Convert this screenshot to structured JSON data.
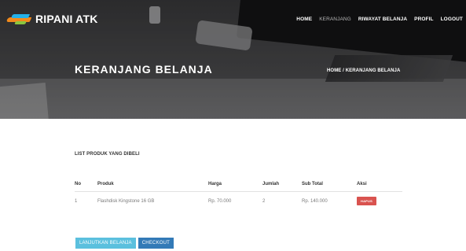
{
  "brand": {
    "name": "RIPANI ATK",
    "logo_colors": [
      "#f28a1c",
      "#23b0e8",
      "#8cc63f"
    ]
  },
  "nav": {
    "items": [
      {
        "label": "HOME"
      },
      {
        "label": "KERANJANG"
      },
      {
        "label": "RIWAYAT BELANJA"
      },
      {
        "label": "PROFIL"
      },
      {
        "label": "LOGOUT"
      }
    ]
  },
  "hero": {
    "title": "KERANJANG BELANJA",
    "breadcrumb": "HOME / KERANJANG BELANJA"
  },
  "cart": {
    "section_title": "LIST PRODUK YANG DIBELI",
    "columns": [
      "No",
      "Produk",
      "Harga",
      "Jumlah",
      "Sub Total",
      "Aksi"
    ],
    "rows": [
      {
        "no": "1",
        "produk": "Flashdisk Kingstone 16 GB",
        "harga": "Rp. 70.000",
        "jumlah": "2",
        "subtotal": "Rp. 140.000",
        "aksi": "HAPUS"
      }
    ]
  },
  "actions": {
    "continue_label": "LANJUTKAN BELANJA",
    "checkout_label": "CHECKOUT"
  },
  "colors": {
    "hapus": "#d9534f",
    "continue": "#5bc0de",
    "checkout": "#337ab7"
  }
}
